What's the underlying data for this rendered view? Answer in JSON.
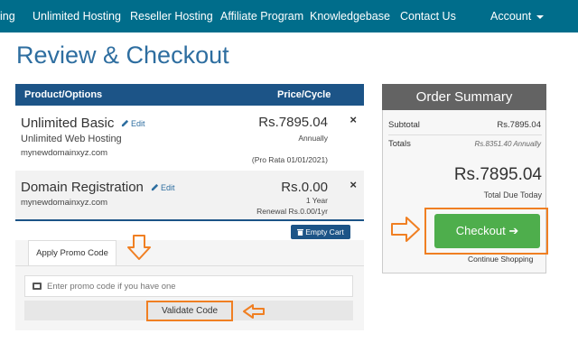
{
  "nav": {
    "items": [
      "ing",
      "Unlimited Hosting",
      "Reseller Hosting",
      "Affiliate Program",
      "Knowledgebase",
      "Contact Us"
    ],
    "account": "Account"
  },
  "page_title": "Review & Checkout",
  "cart": {
    "header_left": "Product/Options",
    "header_right": "Price/Cycle",
    "items": [
      {
        "name": "Unlimited Basic",
        "edit": "Edit",
        "subtitle": "Unlimited Web Hosting",
        "domain": "mynewdomainxyz.com",
        "price": "Rs.7895.04",
        "cycle": "Annually",
        "note": "(Pro Rata 01/01/2021)",
        "remove": "×"
      },
      {
        "name": "Domain Registration",
        "edit": "Edit",
        "domain": "mynewdomainxyz.com",
        "price": "Rs.0.00",
        "cycle": "1 Year",
        "renewal": "Renewal Rs.0.00/1yr",
        "remove": "×"
      }
    ],
    "empty_cart": "Empty Cart"
  },
  "promo": {
    "tab_label": "Apply Promo Code",
    "placeholder": "Enter promo code if you have one",
    "validate_label": "Validate Code"
  },
  "summary": {
    "title": "Order Summary",
    "subtotal_label": "Subtotal",
    "subtotal_value": "Rs.7895.04",
    "totals_label": "Totals",
    "totals_value": "Rs.8351.40 Annually",
    "total_due": "Rs.7895.04",
    "total_due_caption": "Total Due Today",
    "checkout_label": "Checkout",
    "checkout_arrow": "➔",
    "continue_label": "Continue Shopping"
  },
  "colors": {
    "nav_bg": "#006d8b",
    "header_blue": "#1c5487",
    "title_blue": "#2e6ea0",
    "checkout_green": "#4eae4c",
    "highlight_orange": "#f07f22"
  }
}
